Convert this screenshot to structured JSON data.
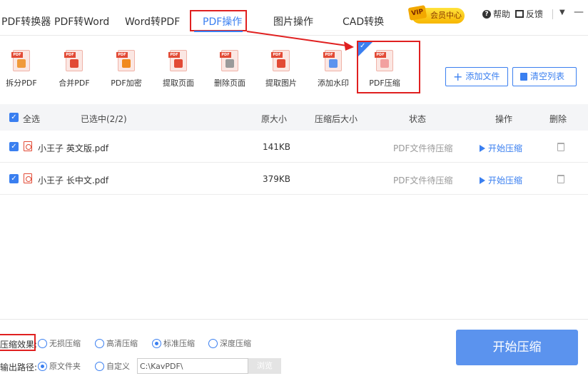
{
  "menu": [
    {
      "label": "PDF转换器"
    },
    {
      "label": "PDF转Word"
    },
    {
      "label": "Word转PDF"
    },
    {
      "label": "PDF操作"
    },
    {
      "label": "图片操作"
    },
    {
      "label": "CAD转换"
    }
  ],
  "header": {
    "vip_badge": "VIP",
    "vip_label": "会员中心",
    "help": "帮助",
    "feedback": "反馈",
    "menu_icon": "▼",
    "minimize": "—"
  },
  "tools": [
    {
      "label": "拆分PDF",
      "tag": "PDF",
      "color": "#f09a3b"
    },
    {
      "label": "合并PDF",
      "tag": "PDF",
      "color": "#e24a35"
    },
    {
      "label": "PDF加密",
      "tag": "PDF",
      "color": "#f08a1f"
    },
    {
      "label": "提取页面",
      "tag": "PDF",
      "color": "#e24a35"
    },
    {
      "label": "删除页面",
      "tag": "PDF",
      "color": "#9a9a9a"
    },
    {
      "label": "提取图片",
      "tag": "PDF",
      "color": "#e24a35"
    },
    {
      "label": "添加水印",
      "tag": "PDF",
      "color": "#5b93ee"
    },
    {
      "label": "PDF压缩",
      "tag": "PDF",
      "color": "#f2a0a0"
    }
  ],
  "actions": {
    "add_file": "添加文件",
    "clear_list": "清空列表"
  },
  "table": {
    "select_all": "全选",
    "selected_count": "已选中(2/2)",
    "col_size": "原大小",
    "col_compressed": "压缩后大小",
    "col_status": "状态",
    "col_action": "操作",
    "col_delete": "删除",
    "rows": [
      {
        "name": "小王子 英文版.pdf",
        "size": "141KB",
        "compressed": "",
        "status": "PDF文件待压缩",
        "action": "开始压缩"
      },
      {
        "name": "小王子 长中文.pdf",
        "size": "379KB",
        "compressed": "",
        "status": "PDF文件待压缩",
        "action": "开始压缩"
      }
    ]
  },
  "options": {
    "effect_label": "压缩效果:",
    "effects": [
      "无损压缩",
      "高清压缩",
      "标准压缩",
      "深度压缩"
    ],
    "effect_selected": "标准压缩",
    "output_label": "输出路径:",
    "output_options": [
      "原文件夹",
      "自定义"
    ],
    "output_selected": "原文件夹",
    "output_path": "C:\\KavPDF\\",
    "browse": "浏览",
    "start": "开始压缩"
  },
  "colors": {
    "accent": "#3a7ff0",
    "highlight": "#e02020"
  }
}
